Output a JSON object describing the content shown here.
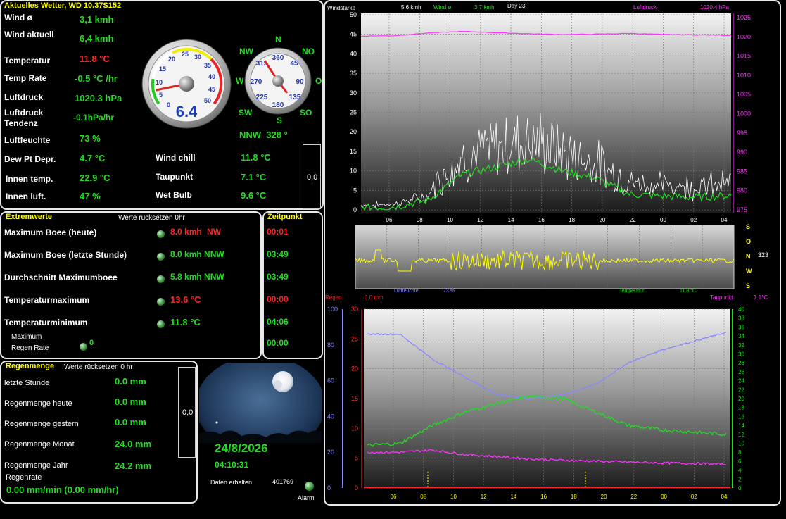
{
  "current": {
    "title": "Aktuelles Wetter, WD 10.37S152",
    "rows": [
      {
        "label": "Wind ø",
        "value": "3,1 kmh"
      },
      {
        "label": "Wind aktuell",
        "value": "6,4 kmh"
      },
      {
        "label": "Temperatur",
        "value": "11.8 °C"
      },
      {
        "label": "Temp Rate",
        "value": "-0.5 °C /hr"
      },
      {
        "label": "Luftdruck",
        "value": "1020.3 hPa"
      },
      {
        "label": "Luftdruck Tendenz",
        "value": "-0.1hPa/hr"
      },
      {
        "label": "Luftfeuchte",
        "value": "73 %"
      },
      {
        "label": "Dew Pt Depr.",
        "value": "4.7 °C"
      },
      {
        "label": "Innen temp.",
        "value": "22.9 °C"
      },
      {
        "label": "Innen luft.",
        "value": "47 %"
      }
    ],
    "right_rows": [
      {
        "label": "Wind chill",
        "value": "11.8 °C"
      },
      {
        "label": "Taupunkt",
        "value": "7.1 °C"
      },
      {
        "label": "Wet Bulb",
        "value": "9.6 °C"
      }
    ],
    "gauge_value": "6.4",
    "gauge_ticks": [
      "0",
      "5",
      "10",
      "15",
      "20",
      "25",
      "30",
      "35",
      "40",
      "45",
      "50"
    ],
    "compass": {
      "N": "N",
      "NO": "NO",
      "O": "O",
      "SO": "SO",
      "S": "S",
      "SW": "SW",
      "W": "W",
      "NW": "NW"
    },
    "compass_ticks": [
      "360",
      "45",
      "90",
      "135",
      "180",
      "225",
      "270",
      "315"
    ],
    "direction_text": "NNW  328 °",
    "box_value": "0,0"
  },
  "extremes": {
    "title": "Extremwerte",
    "reset": "Werte rücksetzen 0hr",
    "time_title": "Zeitpunkt",
    "rows": [
      {
        "label": "Maximum Boee (heute)",
        "value": "8.0 kmh",
        "dir": "NW",
        "time": "00:01",
        "highlight": true
      },
      {
        "label": "Maximum Boee (letzte Stunde)",
        "value": "8.0 kmh NNW",
        "dir": "",
        "time": "03:49",
        "highlight": false
      },
      {
        "label": "Durchschnitt Maximumboee",
        "value": "5.8 kmh NNW",
        "dir": "",
        "time": "03:49",
        "highlight": false
      },
      {
        "label": "Temperaturmaximum",
        "value": "13.6 °C",
        "dir": "",
        "time": "00:00",
        "highlight": true
      },
      {
        "label": "Temperaturminimum",
        "value": "11.8 °C",
        "dir": "",
        "time": "04:06",
        "highlight": false
      }
    ],
    "rain_rate_label_1": "Maximum",
    "rain_rate_label_2": "Regen Rate",
    "rain_rate_value": "0",
    "rain_rate_time": "00:00"
  },
  "rain": {
    "title": "Regenmenge",
    "reset": "Werte rücksetzen 0 hr",
    "rows": [
      {
        "label": "letzte Stunde",
        "value": "0.0 mm"
      },
      {
        "label": "Regenmenge heute",
        "value": "0.0 mm"
      },
      {
        "label": "Regenmenge gestern",
        "value": "0.0 mm"
      },
      {
        "label": "Regenmenge Monat",
        "value": "24.0 mm"
      },
      {
        "label": "Regenmenge Jahr",
        "value": "24.2 mm"
      }
    ],
    "rate_label": "Regenrate",
    "rate_value": "0.00 mm/min (0.00 mm/hr)",
    "box_value": "0,0"
  },
  "status": {
    "date": "24/8/2026",
    "time": "04:10:31",
    "received_label": "Daten erhalten",
    "received_count": "401769",
    "alarm": "Alarm"
  },
  "chart_data": [
    {
      "type": "line",
      "header": {
        "windlabel": "Windstärke",
        "wind_now": "5.6 kmh",
        "wind_avg_label": "Wind ø",
        "wind_avg": "3.7 kmh",
        "day": "Day 23",
        "pressure_label": "Luftdruck",
        "pressure": "1020.4 hPa"
      },
      "x_ticks": [
        "06",
        "08",
        "10",
        "12",
        "14",
        "16",
        "18",
        "20",
        "22",
        "00",
        "02",
        "04"
      ],
      "y_left": [
        0,
        5,
        10,
        15,
        20,
        25,
        30,
        35,
        40,
        45,
        50
      ],
      "y_right": [
        975,
        980,
        985,
        990,
        995,
        1000,
        1005,
        1010,
        1015,
        1020,
        1025
      ],
      "series": [
        {
          "name": "Luftdruck",
          "color": "#ff33ff",
          "values": [
            1020.2,
            1020.3,
            1021,
            1021.4,
            1021.1,
            1020.8,
            1020.6,
            1020.7,
            1020.9,
            1020.6,
            1020.5,
            1020.4
          ]
        },
        {
          "name": "Wind ø",
          "color": "#22dd22",
          "values": [
            0.5,
            0.8,
            2.5,
            9,
            11,
            13,
            10,
            8,
            4,
            3.5,
            3.2,
            3.7
          ]
        }
      ]
    },
    {
      "type": "line",
      "labels": [
        "S",
        "O",
        "N",
        "W",
        "S"
      ],
      "value": "323",
      "footer": {
        "rain_label": "Regen",
        "rain": "0.0 mm",
        "hum_label": "Luftfeuchte",
        "hum": "73 %",
        "temp_label": "Temperatur",
        "temp": "11.8 °C",
        "dew_label": "Taupunkt",
        "dew": "7.1°C"
      }
    },
    {
      "type": "line",
      "x_ticks": [
        "06",
        "08",
        "10",
        "12",
        "14",
        "16",
        "18",
        "20",
        "22",
        "00",
        "02",
        "04"
      ],
      "y_left": [
        0,
        20,
        40,
        60,
        80,
        100
      ],
      "y_mid": [
        0,
        5,
        10,
        15,
        20,
        25,
        30
      ],
      "y_right": [
        "0",
        "2",
        "4",
        "6",
        "8",
        "10",
        "12",
        "14",
        "16",
        "18",
        "20",
        "22",
        "24",
        "26",
        "28",
        "30",
        "32",
        "34",
        "36",
        "38",
        "40"
      ],
      "series": [
        {
          "name": "Luftfeuchte",
          "color": "#8888ff",
          "values": [
            86,
            86,
            72,
            62,
            52,
            50,
            52,
            58,
            70,
            77,
            82,
            87
          ]
        },
        {
          "name": "Temperatur",
          "color": "#22dd22",
          "values": [
            9.5,
            10,
            14,
            17,
            19,
            20.5,
            20,
            17,
            14,
            13,
            12.5,
            12
          ]
        },
        {
          "name": "Taupunkt",
          "color": "#ff33ff",
          "values": [
            8,
            8,
            8.5,
            7.5,
            7,
            6.5,
            6.2,
            6,
            5.8,
            5.6,
            5.5,
            5.3
          ]
        }
      ]
    }
  ]
}
